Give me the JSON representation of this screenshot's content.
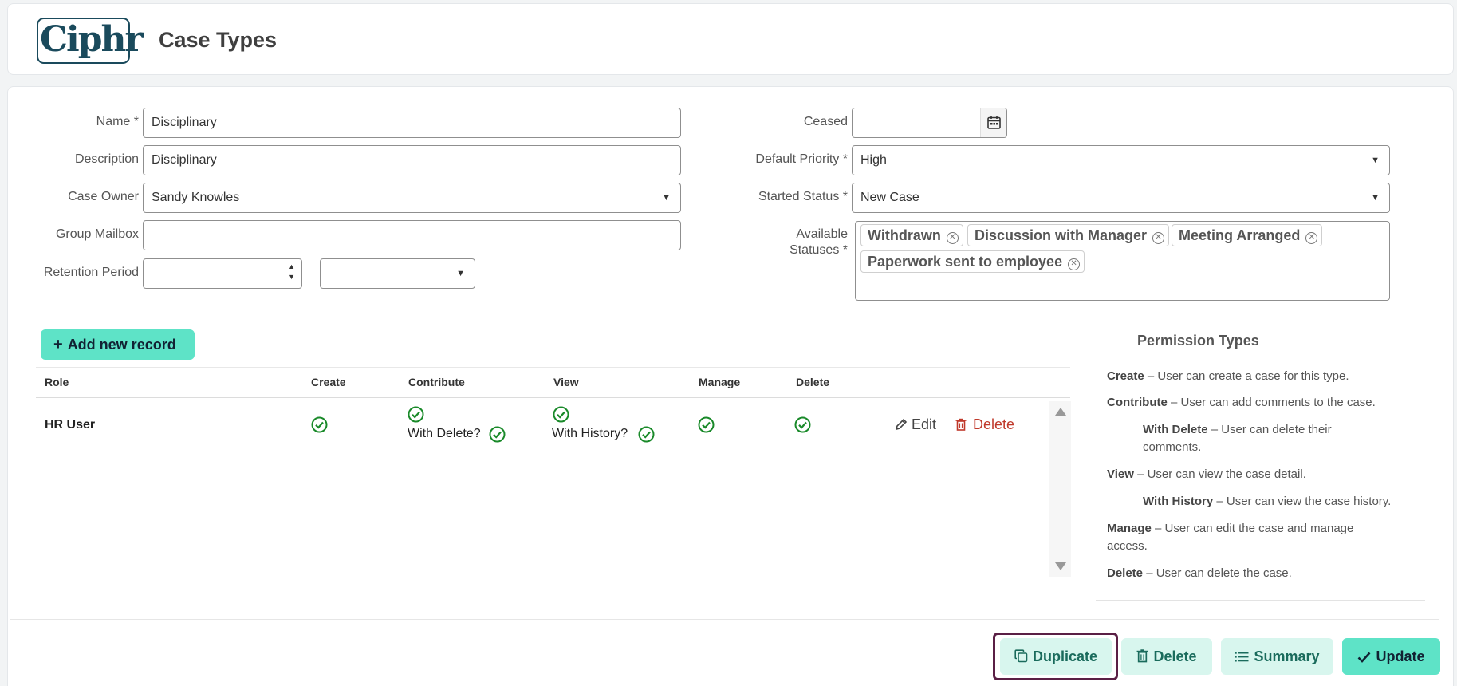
{
  "header": {
    "logo_text": "Ciphr",
    "title": "Case Types"
  },
  "form": {
    "name": {
      "label": "Name *",
      "value": "Disciplinary"
    },
    "description": {
      "label": "Description",
      "value": "Disciplinary"
    },
    "case_owner": {
      "label": "Case Owner",
      "value": "Sandy Knowles"
    },
    "group_mailbox": {
      "label": "Group Mailbox",
      "value": ""
    },
    "retention_period": {
      "label": "Retention Period",
      "value": "",
      "unit_value": ""
    },
    "ceased": {
      "label": "Ceased",
      "value": ""
    },
    "default_priority": {
      "label": "Default Priority *",
      "value": "High"
    },
    "started_status": {
      "label": "Started Status *",
      "value": "New Case"
    },
    "available_statuses": {
      "label_line1": "Available",
      "label_line2": "Statuses *",
      "chips": [
        "Withdrawn",
        "Discussion with Manager",
        "Meeting Arranged",
        "Paperwork sent to employee"
      ]
    }
  },
  "table": {
    "add_button": "Add new record",
    "columns": [
      "Role",
      "Create",
      "Contribute",
      "View",
      "Manage",
      "Delete"
    ],
    "rows": [
      {
        "role": "HR User",
        "contribute_sub": "With Delete?",
        "view_sub": "With History?",
        "edit": "Edit",
        "delete": "Delete"
      }
    ]
  },
  "permissions": {
    "title": "Permission Types",
    "items": [
      {
        "term": "Create",
        "desc": " – User can create a case for this type."
      },
      {
        "term": "Contribute",
        "desc": " – User can add comments to the case."
      },
      {
        "term": "With Delete",
        "desc": " – User can delete their",
        "desc2": "comments."
      },
      {
        "term": "View",
        "desc": " – User can view the case detail."
      },
      {
        "term": "With History",
        "desc": " – User can view the case history."
      },
      {
        "term": "Manage",
        "desc": " – User can edit the case and manage",
        "desc2": "access."
      },
      {
        "term": "Delete",
        "desc": " – User can delete the case."
      }
    ]
  },
  "footer": {
    "duplicate": "Duplicate",
    "delete": "Delete",
    "summary": "Summary",
    "update": "Update"
  },
  "colors": {
    "accent": "#5ee3c7",
    "check": "#1a8a2a",
    "danger": "#c0392b",
    "focus": "#5a1f45"
  }
}
